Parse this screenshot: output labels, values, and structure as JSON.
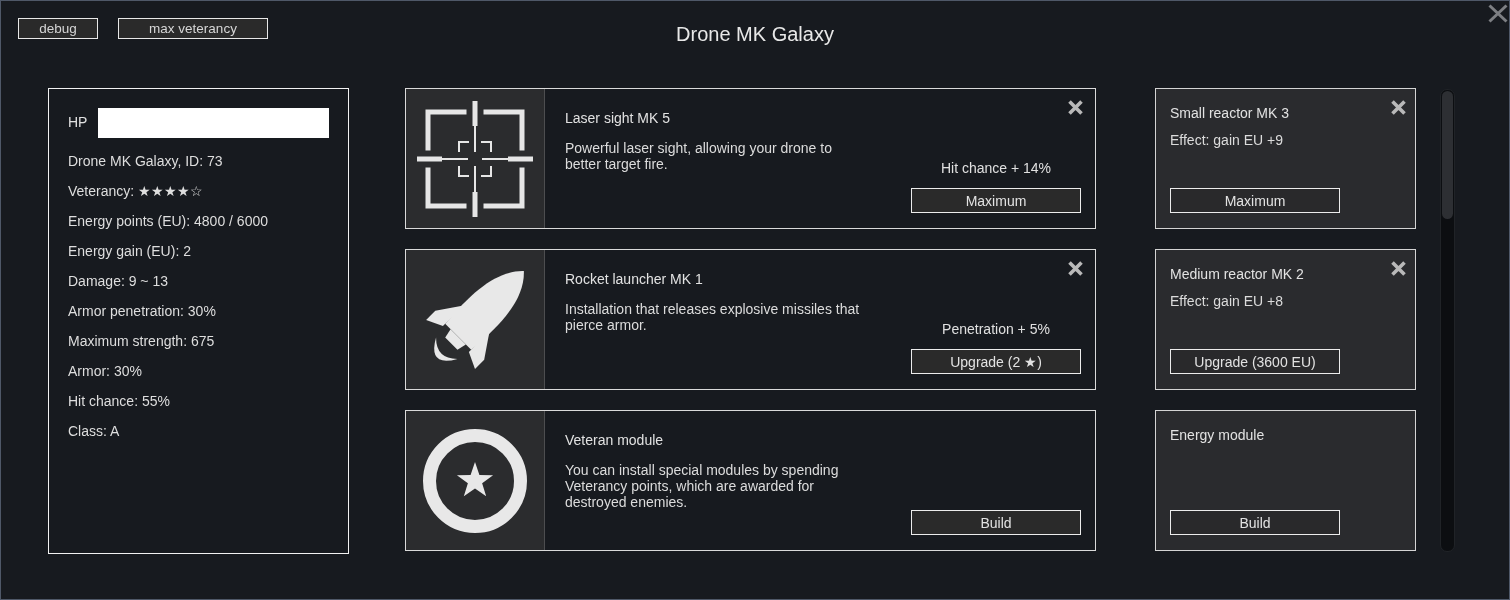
{
  "window": {
    "title": "Drone MK Galaxy"
  },
  "toolbar": [
    {
      "label": "debug"
    },
    {
      "label": "max veterancy"
    }
  ],
  "stats": {
    "hp": {
      "label": "HP",
      "level": 1
    },
    "lines": [
      "Drone MK Galaxy, ID: 73",
      "Veterancy: ★★★★☆",
      "Energy points (EU): 4800 / 6000",
      "Energy gain (EU): 2",
      "Damage: 9 ~ 13",
      "Armor penetration: 30%",
      "Maximum strength: 675",
      "Armor: 30%",
      "Hit chance: 55%",
      "Class: A"
    ]
  },
  "modules": [
    {
      "title": "Laser sight MK 5",
      "description": "Powerful laser sight, allowing your drone to better target fire.",
      "effect": "Hit chance + 14%",
      "button": "Maximum",
      "removable": true
    },
    {
      "title": "Rocket launcher MK 1",
      "description": "Installation that releases explosive missiles that pierce armor.",
      "effect": "Penetration + 5%",
      "button": "Upgrade (2 ★)",
      "removable": true
    },
    {
      "title": "Veteran module",
      "description": "You can install special modules by spending Veterancy points, which are awarded for destroyed enemies.",
      "button": "Build",
      "removable": false
    }
  ],
  "side_modules": [
    {
      "title": "Small reactor MK 3",
      "effect": "Effect: gain EU +9",
      "button": "Maximum",
      "removable": true
    },
    {
      "title": "Medium reactor MK 2",
      "effect": "Effect: gain EU +8",
      "button": "Upgrade (3600 EU)",
      "removable": true
    },
    {
      "title": "Energy module",
      "button": "Build",
      "removable": false
    }
  ]
}
